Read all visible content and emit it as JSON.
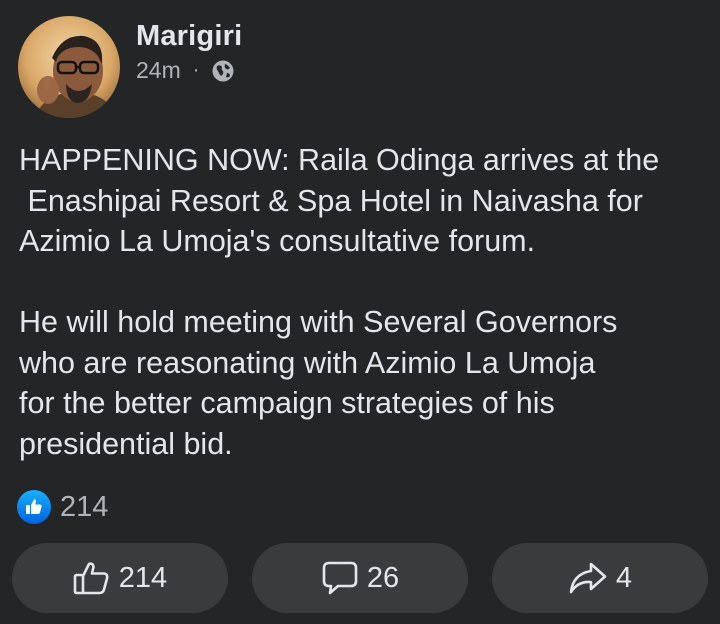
{
  "post": {
    "author": "Marigiri",
    "time": "24m",
    "separator": "·",
    "privacy_icon": "globe-icon",
    "paragraphs": [
      "HAPPENING NOW: Raila Odinga arrives at the\n Enashipai Resort & Spa Hotel in Naivasha for\nAzimio La Umoja's consultative forum.",
      "He will hold meeting with Several Governors\nwho are reasonating with Azimio La Umoja\nfor the better campaign strategies of his\npresidential bid."
    ]
  },
  "reactions": {
    "icon": "like-reaction-icon",
    "count": "214"
  },
  "actions": {
    "like": {
      "icon": "thumbs-up-icon",
      "count": "214"
    },
    "comment": {
      "icon": "comment-icon",
      "count": "26"
    },
    "share": {
      "icon": "share-icon",
      "count": "4"
    }
  },
  "colors": {
    "background": "#242526",
    "button_background": "#3a3b3c",
    "primary_text": "#e4e6eb",
    "secondary_text": "#b0b3b8",
    "like_blue": "#1877f2"
  }
}
